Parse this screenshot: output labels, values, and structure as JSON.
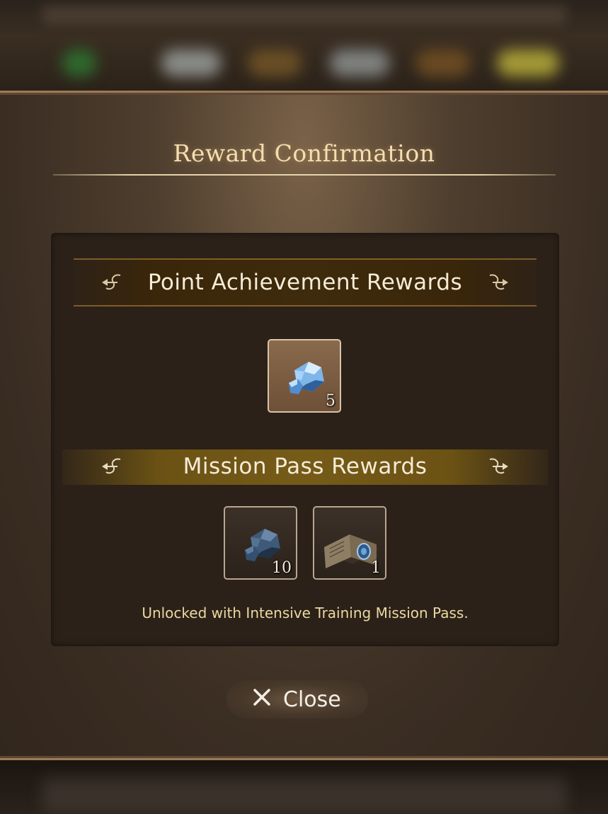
{
  "dialog": {
    "title": "Reward Confirmation",
    "close_label": "Close"
  },
  "sections": [
    {
      "label": "Point Achievement Rewards",
      "items": [
        {
          "icon": "blue-ore-icon",
          "quantity": "5"
        }
      ]
    },
    {
      "label": "Mission Pass Rewards",
      "items": [
        {
          "icon": "dark-ore-icon",
          "quantity": "10"
        },
        {
          "icon": "skill-book-icon",
          "quantity": "1"
        }
      ],
      "note": "Unlocked with Intensive Training Mission Pass."
    }
  ],
  "colors": {
    "title": "#f3deb0",
    "note": "#ead9a0",
    "pass_banner": "#765b18"
  }
}
